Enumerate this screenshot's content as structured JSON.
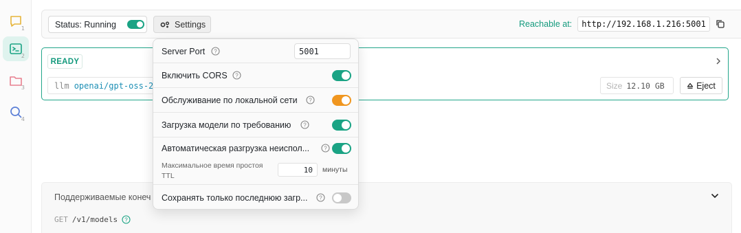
{
  "colors": {
    "accent": "#1aa384",
    "warning_toggle": "#f0961f",
    "toggle_off": "#c8c8c8",
    "link_blue": "#1d8fb5"
  },
  "rail": {
    "items": [
      {
        "icon": "chat-icon",
        "number": "1",
        "color": "#e6b43a"
      },
      {
        "icon": "terminal-icon",
        "number": "2",
        "color": "#1aa384"
      },
      {
        "icon": "folder-icon",
        "number": "3",
        "color": "#e8808f"
      },
      {
        "icon": "search-icon",
        "number": "4",
        "color": "#5b7fd6"
      }
    ]
  },
  "header": {
    "status_label": "Status: Running",
    "settings_label": "Settings",
    "reachable_label": "Reachable at:",
    "reachable_url": "http://192.168.1.216:5001"
  },
  "model_card": {
    "status": "READY",
    "cmd_prefix": "llm",
    "model_name": "openai/gpt-oss-2",
    "size_label": "Size",
    "size_value": "12.10 GB",
    "eject_label": "Eject"
  },
  "settings": {
    "server_port_label": "Server Port",
    "server_port_value": "5001",
    "rows": [
      {
        "label": "Включить CORS",
        "enabled": true
      },
      {
        "label": "Обслуживание по локальной сети",
        "enabled": true
      },
      {
        "label": "Загрузка модели по требованию",
        "enabled": true
      },
      {
        "label": "Автоматическая разгрузка неиспол...",
        "enabled": true
      }
    ],
    "ttl_label_line1": "Максимальное время простоя",
    "ttl_label_line2": "TTL",
    "ttl_value": "10",
    "ttl_unit": "минуты",
    "keep_last_label": "Сохранять только последнюю загр...",
    "keep_last_enabled": false
  },
  "endpoints": {
    "title": "Поддерживаемые конеч",
    "method": "GET",
    "path": "/v1/models"
  }
}
